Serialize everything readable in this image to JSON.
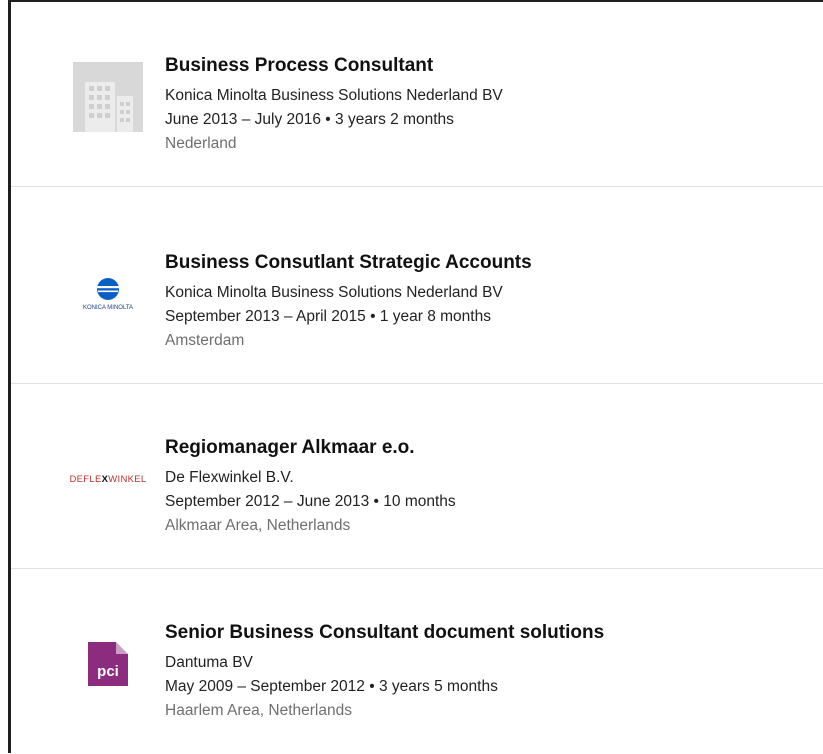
{
  "experience": [
    {
      "title": "Business Process Consultant",
      "company": "Konica Minolta Business Solutions Nederland BV",
      "dates": "June 2013 – July 2016 • 3 years 2 months",
      "location": "Nederland",
      "logo_icon": "building-icon"
    },
    {
      "title": "Business Consutlant Strategic Accounts",
      "company": "Konica Minolta Business Solutions Nederland BV",
      "dates": "September 2013 – April 2015 • 1 year 8 months",
      "location": "Amsterdam",
      "logo_icon": "konica-minolta-logo",
      "logo_text": "KONICA MINOLTA"
    },
    {
      "title": "Regiomanager Alkmaar e.o.",
      "company": "De Flexwinkel B.V.",
      "dates": "September 2012 – June 2013 • 10 months",
      "location": "Alkmaar Area, Netherlands",
      "logo_icon": "deflexwinkel-logo",
      "logo_text_a": "DEFLE",
      "logo_text_b": "X",
      "logo_text_c": "WINKEL"
    },
    {
      "title": "Senior Business Consultant document solutions",
      "company": "Dantuma BV",
      "dates": "May 2009 – September 2012 • 3 years 5 months",
      "location": "Haarlem Area, Netherlands",
      "logo_icon": "pci-logo",
      "logo_text": "pci"
    }
  ],
  "colors": {
    "title": "#111111",
    "location": "#6f6f6f",
    "divider": "#e1e1e1",
    "pci_purple": "#8b2c7f",
    "konica_blue": "#0a5fc4"
  }
}
